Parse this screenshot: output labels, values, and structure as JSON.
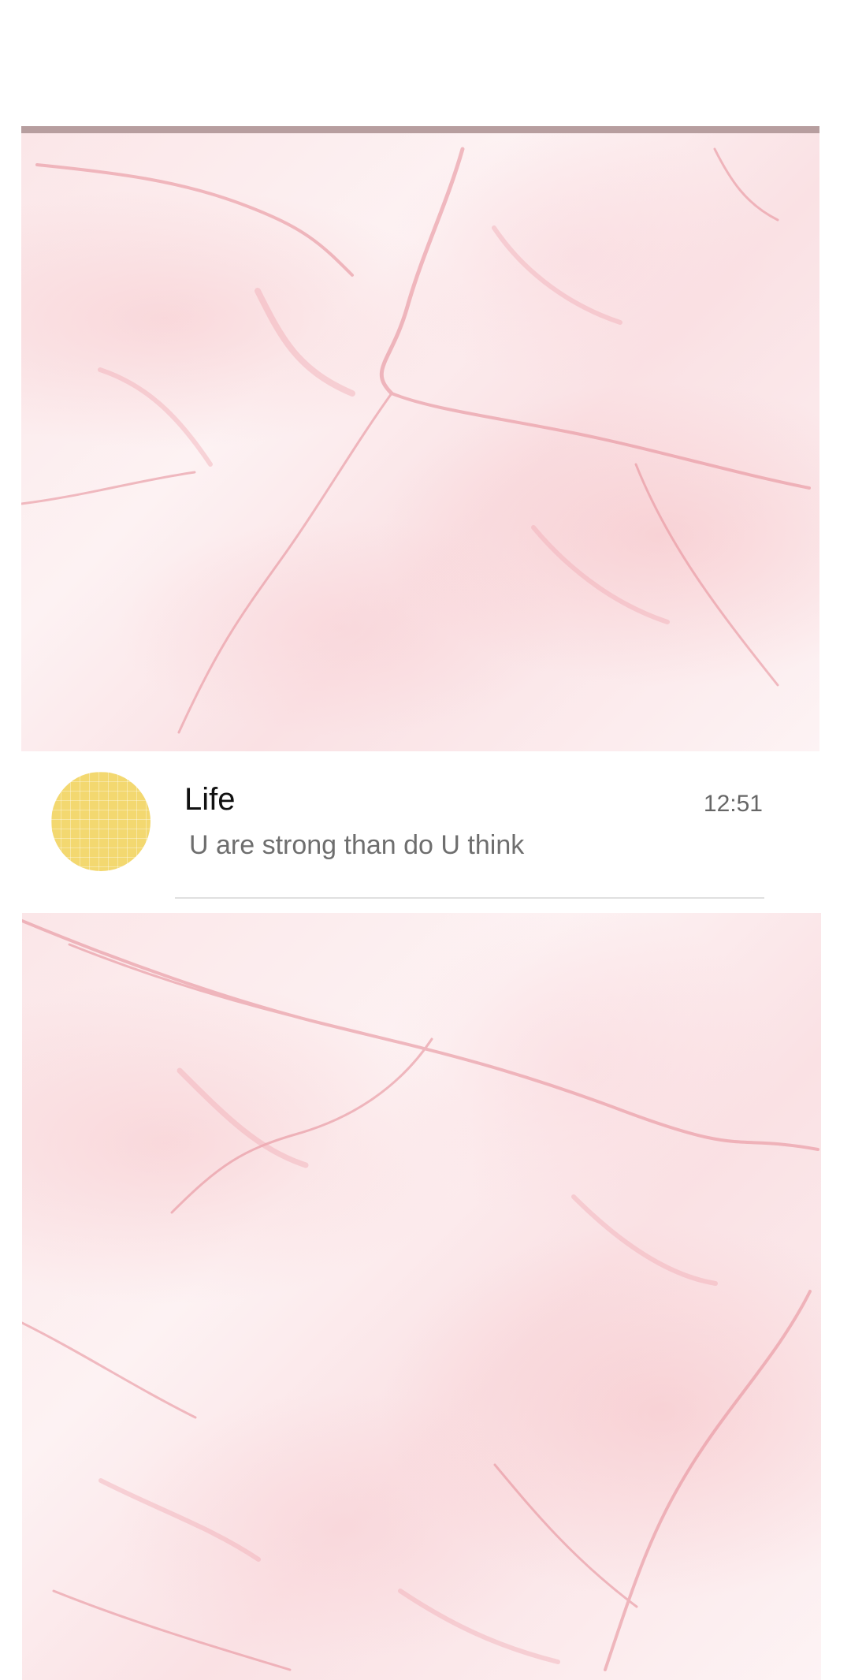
{
  "images": {
    "top": {
      "name": "pink-marble-image"
    },
    "bottom": {
      "name": "pink-marble-image"
    }
  },
  "chat": {
    "name": "Life",
    "time": "12:51",
    "preview": "U are strong than do U think",
    "avatar_color": "#f3d870"
  },
  "colors": {
    "marble_base": "#fbe6e8",
    "vein": "#e58a95",
    "divider": "#e0e0e0"
  }
}
